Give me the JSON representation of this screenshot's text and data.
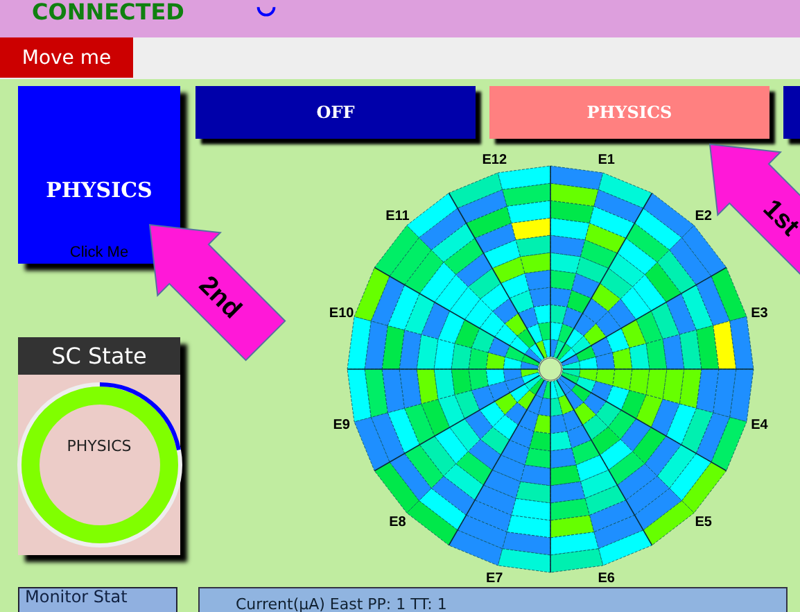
{
  "status": {
    "text": "CONNECTED"
  },
  "move_button": {
    "label": "Move me"
  },
  "mode_tile": {
    "label": "PHYSICS",
    "hint": "Click Me"
  },
  "mode_buttons": [
    {
      "label": "OFF",
      "selected": false
    },
    {
      "label": "PHYSICS",
      "selected": true
    },
    {
      "selected": false
    }
  ],
  "arrows": [
    {
      "label": "1st"
    },
    {
      "label": "2nd"
    }
  ],
  "sc_state": {
    "title": "SC State",
    "state": "PHYSICS",
    "level": 0.22
  },
  "detector_map": {
    "sectors": [
      "E1",
      "E2",
      "E3",
      "E4",
      "E5",
      "E6",
      "E7",
      "E8",
      "E9",
      "E10",
      "E11",
      "E12"
    ]
  },
  "bottom": {
    "monitor_title": "Monitor Stat",
    "current_text": "Current(µA) East PP: 1 TT: 1"
  }
}
